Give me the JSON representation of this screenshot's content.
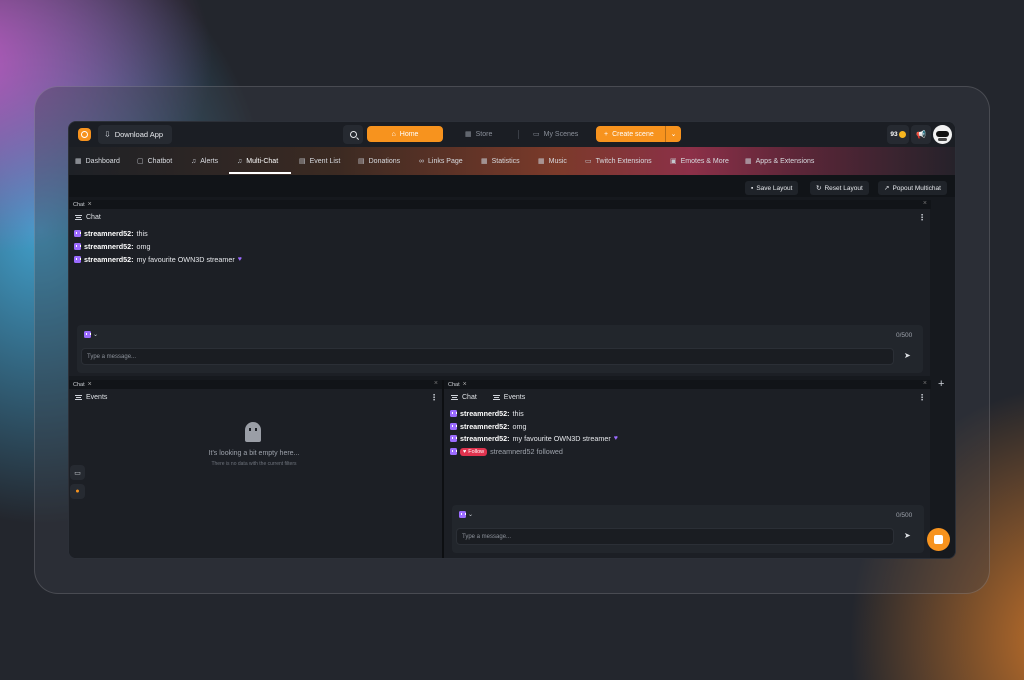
{
  "topbar": {
    "download_label": "Download App",
    "home_label": "Home",
    "store_label": "Store",
    "scenes_label": "My Scenes",
    "create_label": "Create scene",
    "coins": "93"
  },
  "menu": {
    "items": [
      {
        "label": "Dashboard",
        "icon": "grid-icon"
      },
      {
        "label": "Chatbot",
        "icon": "chat-bubble-icon"
      },
      {
        "label": "Alerts",
        "icon": "bell-icon"
      },
      {
        "label": "Multi-Chat",
        "icon": "bell-icon"
      },
      {
        "label": "Event List",
        "icon": "list-icon"
      },
      {
        "label": "Donations",
        "icon": "donation-icon"
      },
      {
        "label": "Links Page",
        "icon": "link-icon"
      },
      {
        "label": "Statistics",
        "icon": "stats-icon"
      },
      {
        "label": "Music",
        "icon": "music-icon"
      },
      {
        "label": "Twitch Extensions",
        "icon": "extension-icon"
      },
      {
        "label": "Emotes & More",
        "icon": "emote-icon"
      },
      {
        "label": "Apps & Extensions",
        "icon": "apps-icon"
      }
    ],
    "active": "Multi-Chat"
  },
  "toolbar": {
    "save_label": "Save Layout",
    "reset_label": "Reset Layout",
    "popout_label": "Popout Multichat"
  },
  "panels": {
    "top": {
      "tab_label": "Chat",
      "header_label": "Chat",
      "messages": [
        {
          "user": "streamnerd52:",
          "text": "this"
        },
        {
          "user": "streamnerd52:",
          "text": "omg"
        },
        {
          "user": "streamnerd52:",
          "text": "my favourite OWN3D streamer"
        }
      ],
      "counter": "0/500",
      "input_placeholder": "Type a message..."
    },
    "bottom_left": {
      "tab_label": "Chat",
      "header_label": "Events",
      "empty_title": "It's looking a bit empty here...",
      "empty_sub": "There is no data with the current filters"
    },
    "bottom_right": {
      "tab_label": "Chat",
      "header_chat": "Chat",
      "header_events": "Events",
      "messages": [
        {
          "user": "streamnerd52:",
          "text": "this"
        },
        {
          "user": "streamnerd52:",
          "text": "omg"
        },
        {
          "user": "streamnerd52:",
          "text": "my favourite OWN3D streamer"
        }
      ],
      "follow_badge": "Follow",
      "follow_text": "streamnerd52 followed",
      "counter": "0/500",
      "input_placeholder": "Type a message..."
    }
  },
  "colors": {
    "accent": "#f7931e",
    "twitch": "#9b6bff",
    "follow": "#e0334f"
  }
}
